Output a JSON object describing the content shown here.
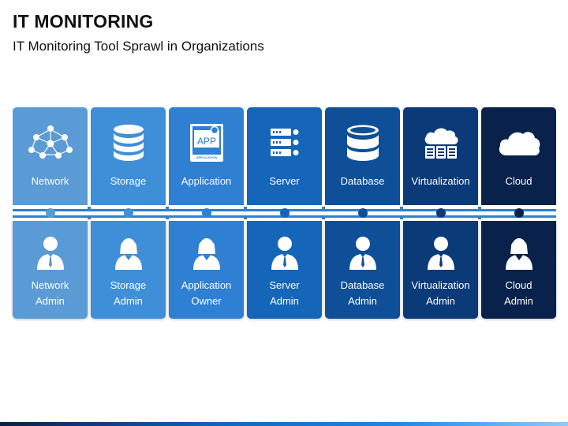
{
  "header": {
    "title": "IT MONITORING",
    "subtitle": "IT Monitoring Tool Sprawl in Organizations"
  },
  "columns": [
    {
      "label": "Network",
      "role_line1": "Network",
      "role_line2": "Admin",
      "color": "#5b9bd5",
      "person": "male"
    },
    {
      "label": "Storage",
      "role_line1": "Storage",
      "role_line2": "Admin",
      "color": "#3f8fd8",
      "person": "female"
    },
    {
      "label": "Application",
      "role_line1": "Application",
      "role_line2": "Owner",
      "color": "#2f7fd2",
      "person": "female"
    },
    {
      "label": "Server",
      "role_line1": "Server",
      "role_line2": "Admin",
      "color": "#1566b8",
      "person": "male"
    },
    {
      "label": "Database",
      "role_line1": "Database",
      "role_line2": "Admin",
      "color": "#0f4f98",
      "person": "male"
    },
    {
      "label": "Virtualization",
      "role_line1": "Virtualization",
      "role_line2": "Admin",
      "color": "#0b3a78",
      "person": "male"
    },
    {
      "label": "Cloud",
      "role_line1": "Cloud",
      "role_line2": "Admin",
      "color": "#08224b",
      "person": "female"
    }
  ],
  "icons": [
    "network-icon",
    "storage-icon",
    "application-icon",
    "server-icon",
    "database-icon",
    "virtualization-icon",
    "cloud-icon"
  ],
  "application_icon_text": {
    "main": "APP",
    "caption": "APPLICATION"
  }
}
